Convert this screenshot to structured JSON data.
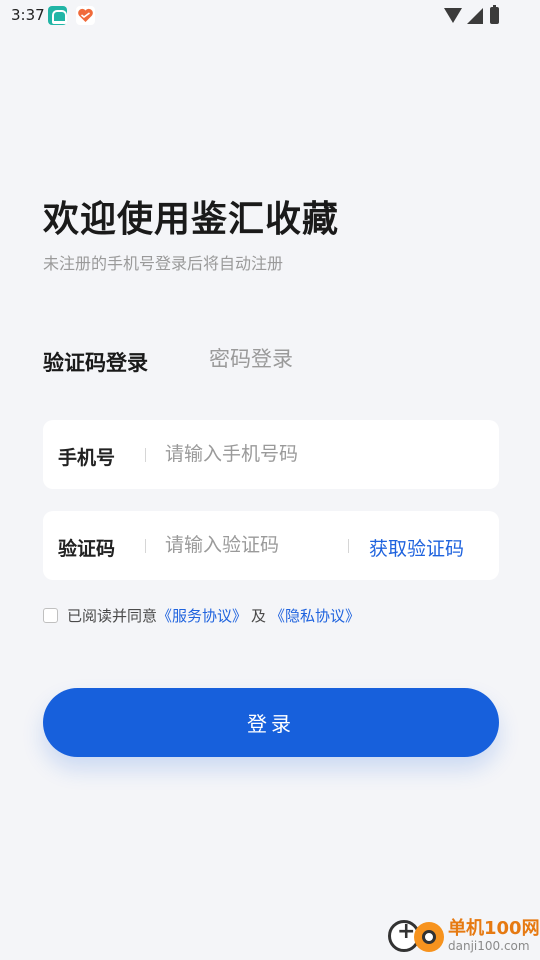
{
  "status_bar": {
    "time": "3:37"
  },
  "header": {
    "title": "欢迎使用鉴汇收藏",
    "subtitle": "未注册的手机号登录后将自动注册"
  },
  "tabs": [
    {
      "label": "验证码登录",
      "active": true
    },
    {
      "label": "密码登录",
      "active": false
    }
  ],
  "form": {
    "phone": {
      "label": "手机号",
      "placeholder": "请输入手机号码",
      "value": ""
    },
    "code": {
      "label": "验证码",
      "placeholder": "请输入验证码",
      "value": "",
      "get_code_label": "获取验证码"
    }
  },
  "agreement": {
    "checked": false,
    "prefix": "已阅读并同意",
    "service_link": "《服务协议》",
    "and": "及",
    "privacy_link": "《隐私协议》"
  },
  "login_button": {
    "label": "登录"
  },
  "watermark": {
    "brand": "单机100网",
    "url": "danji100.com"
  },
  "colors": {
    "primary": "#1760dc",
    "link": "#1f63de",
    "background": "#f4f5f8",
    "tab_underline": "#8fb4ec"
  }
}
